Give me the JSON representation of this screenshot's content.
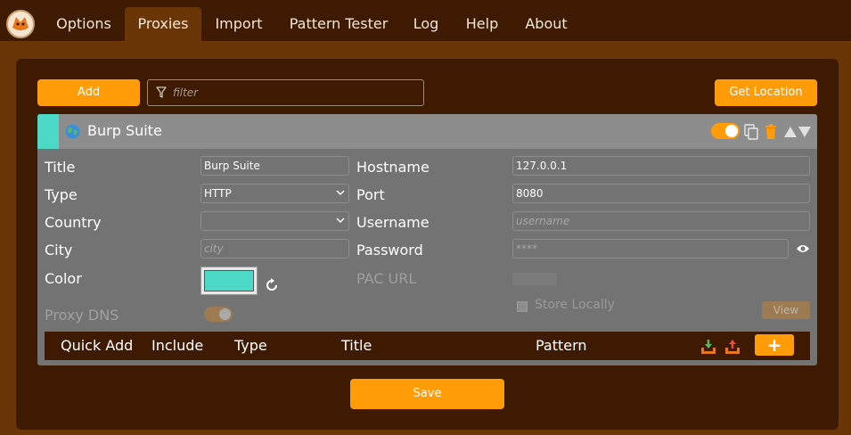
{
  "nav": {
    "tabs": [
      {
        "label": "Options",
        "active": false
      },
      {
        "label": "Proxies",
        "active": true
      },
      {
        "label": "Import",
        "active": false
      },
      {
        "label": "Pattern Tester",
        "active": false
      },
      {
        "label": "Log",
        "active": false
      },
      {
        "label": "Help",
        "active": false
      },
      {
        "label": "About",
        "active": false
      }
    ]
  },
  "toolbar": {
    "add_label": "Add",
    "filter_placeholder": "filter",
    "get_location_label": "Get Location"
  },
  "proxy": {
    "name": "Burp Suite",
    "enabled": true,
    "color": "#4dd9c8",
    "labels": {
      "title": "Title",
      "type": "Type",
      "country": "Country",
      "city": "City",
      "color": "Color",
      "proxy_dns": "Proxy DNS",
      "hostname": "Hostname",
      "port": "Port",
      "username": "Username",
      "password": "Password",
      "pac_url": "PAC URL",
      "store_locally": "Store Locally",
      "view": "View"
    },
    "fields": {
      "title": "Burp Suite",
      "type": "HTTP",
      "country": "",
      "city_placeholder": "city",
      "hostname": "127.0.0.1",
      "port": "8080",
      "username_placeholder": "username",
      "password_placeholder": "****"
    },
    "proxy_dns_enabled": false,
    "patterns_table": {
      "columns": [
        "Quick Add",
        "Include",
        "Type",
        "Title",
        "Pattern"
      ],
      "add_label": "+"
    }
  },
  "footer": {
    "save_label": "Save"
  },
  "colors": {
    "accent": "#ff9c07",
    "nav_bg": "#3d1a01",
    "page_bg": "#6a3608",
    "card_bg": "#737373"
  }
}
